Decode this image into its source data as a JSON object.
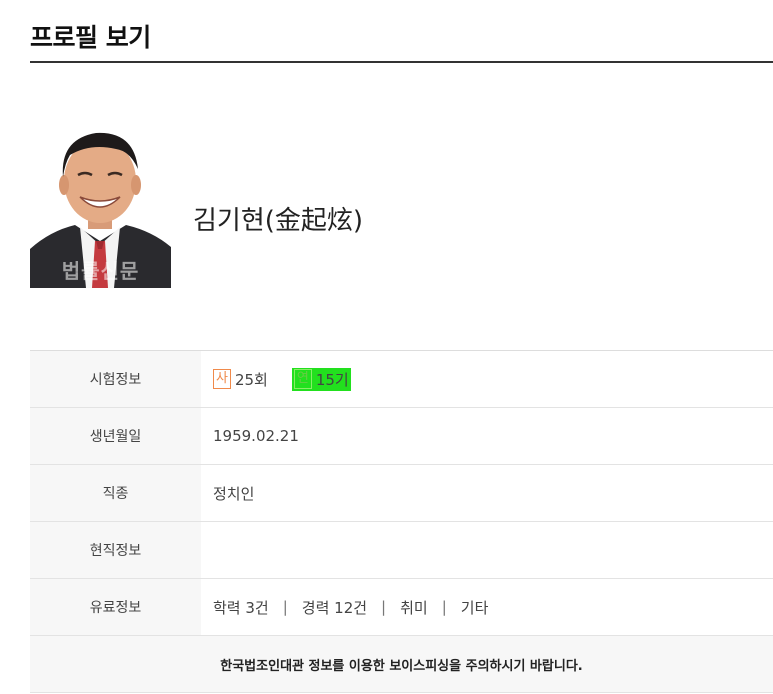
{
  "page": {
    "title": "프로필 보기"
  },
  "profile": {
    "name": "김기현(金起炫)",
    "photo_watermark": "법률신문"
  },
  "info_rows": [
    {
      "label": "시험정보",
      "exams": [
        {
          "badge": "사",
          "value": "25회"
        },
        {
          "badge": "연",
          "value": "15기"
        }
      ]
    },
    {
      "label": "생년월일",
      "value": "1959.02.21"
    },
    {
      "label": "직종",
      "value": "정치인"
    },
    {
      "label": "현직정보",
      "value": ""
    },
    {
      "label": "유료정보",
      "items": [
        "학력 3건",
        "경력 12건",
        "취미",
        "기타"
      ],
      "separator": "|"
    }
  ],
  "notice": "한국법조인대관 정보를 이용한 보이스피싱을 주의하시기 바랍니다.",
  "colors": {
    "exam_badge": "#f08a4b",
    "highlight": "#22e01e"
  }
}
